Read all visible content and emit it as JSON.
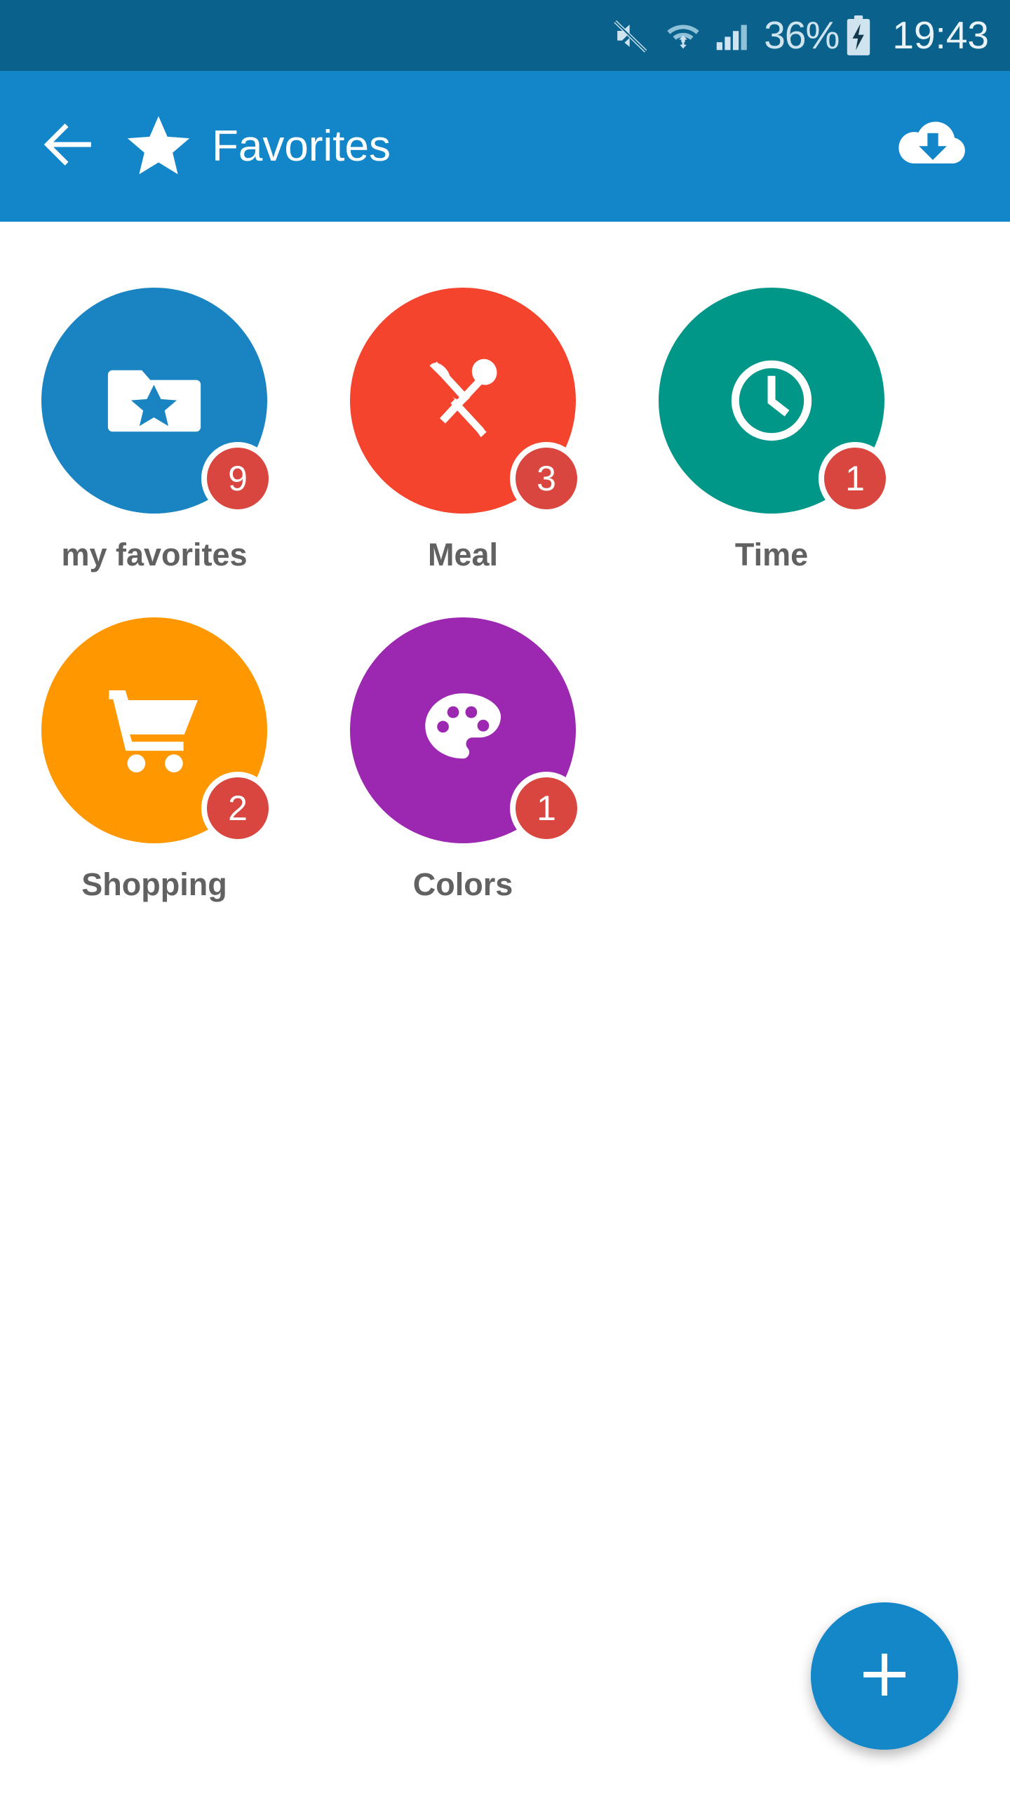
{
  "statusbar": {
    "mute_icon": "mute-icon",
    "wifi_icon": "wifi-icon",
    "signal_icon": "cellular-signal-icon",
    "battery_percent": "36%",
    "battery_icon": "battery-charging-icon",
    "time": "19:43",
    "background_color": "#0a628c",
    "text_color": "#cfe4ef"
  },
  "appbar": {
    "back_icon": "back-arrow-icon",
    "star_icon": "star-icon",
    "title": "Favorites",
    "action_icon": "cloud-download-icon",
    "background_color": "#1286c8",
    "text_color": "#ffffff"
  },
  "grid": {
    "items": [
      {
        "label": "my favorites",
        "badge": "9",
        "color": "#1a84c2",
        "icon": "folder-star-icon"
      },
      {
        "label": "Meal",
        "badge": "3",
        "color": "#f4442e",
        "icon": "spoon-knife-icon"
      },
      {
        "label": "Time",
        "badge": "1",
        "color": "#009688",
        "icon": "clock-icon"
      },
      {
        "label": "Shopping",
        "badge": "2",
        "color": "#ff9800",
        "icon": "shopping-cart-icon"
      },
      {
        "label": "Colors",
        "badge": "1",
        "color": "#9c27b0",
        "icon": "palette-icon"
      }
    ],
    "badge_color": "#d9463f",
    "label_color": "#616161"
  },
  "fab": {
    "icon": "plus-icon",
    "color": "#1387c8"
  }
}
